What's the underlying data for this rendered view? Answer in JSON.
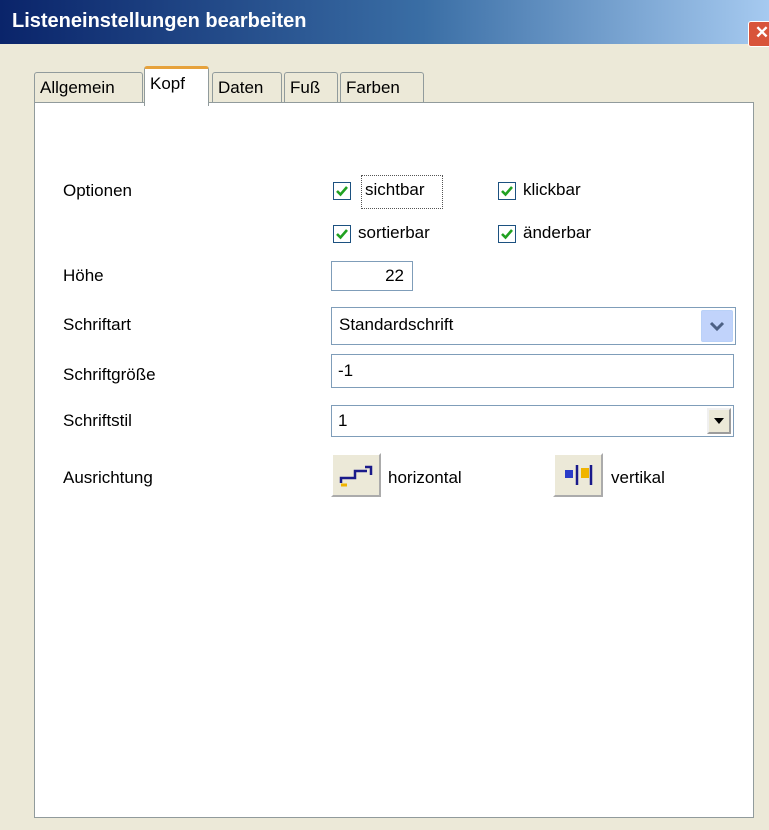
{
  "window": {
    "title": "Listeneinstellungen bearbeiten",
    "close_glyph": "✕"
  },
  "tabs": [
    {
      "label": "Allgemein",
      "active": false
    },
    {
      "label": "Kopf",
      "active": true
    },
    {
      "label": "Daten",
      "active": false
    },
    {
      "label": "Fuß",
      "active": false
    },
    {
      "label": "Farben",
      "active": false
    }
  ],
  "form": {
    "optionen_label": "Optionen",
    "options": [
      {
        "label": "sichtbar",
        "checked": true
      },
      {
        "label": "klickbar",
        "checked": true
      },
      {
        "label": "sortierbar",
        "checked": true
      },
      {
        "label": "änderbar",
        "checked": true
      }
    ],
    "hoehe_label": "Höhe",
    "hoehe_value": "22",
    "schriftart_label": "Schriftart",
    "schriftart_value": "Standardschrift",
    "schriftgroesse_label": "Schriftgröße",
    "schriftgroesse_value": "-1",
    "schriftstil_label": "Schriftstil",
    "schriftstil_value": "1",
    "ausrichtung_label": "Ausrichtung",
    "horizontal_label": "horizontal",
    "vertikal_label": "vertikal"
  },
  "colors": {
    "check": "#21a121",
    "tab_active_accent": "#e6a23c"
  },
  "icons": {
    "checkbox": "checkmark-icon",
    "combo": "chevron-down-icon",
    "align_h": "horizontal-align-icon",
    "align_v": "vertical-align-icon"
  }
}
